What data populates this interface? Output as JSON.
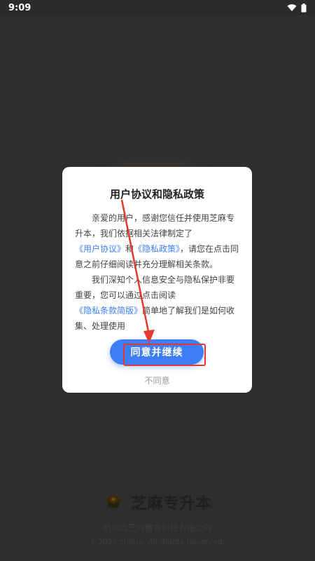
{
  "status_bar": {
    "time": "9:09",
    "icons": [
      "wifi-icon",
      "battery-icon"
    ]
  },
  "dialog": {
    "title": "用户协议和隐私政策",
    "p1_a": "亲爱的用户，感谢您信任并使用芝麻专升本，我们依据相关法律制定了",
    "link_user_agreement": "《用户协议》",
    "p1_b": "和",
    "link_privacy_policy": "《隐私政策》",
    "p1_c": "，请您在点击同意之前仔细阅读并充分理解相关条款。",
    "p2_a": "我们深知个人信息安全与隐私保护非要重要，您可以通过点击阅读",
    "link_privacy_brief": "《隐私条款简版》",
    "p2_b": "简单地了解我们是如何收集、处理使用",
    "agree_label": "同意并继续",
    "disagree_label": "不同意"
  },
  "background": {
    "brand_name": "芝麻专升本",
    "company": "杭州启芝网教育科技有限公司",
    "copyright": "©2025 zhima. All Rights Reserved."
  },
  "colors": {
    "accent": "#3d7ef5",
    "annotation": "#e23b2e"
  }
}
